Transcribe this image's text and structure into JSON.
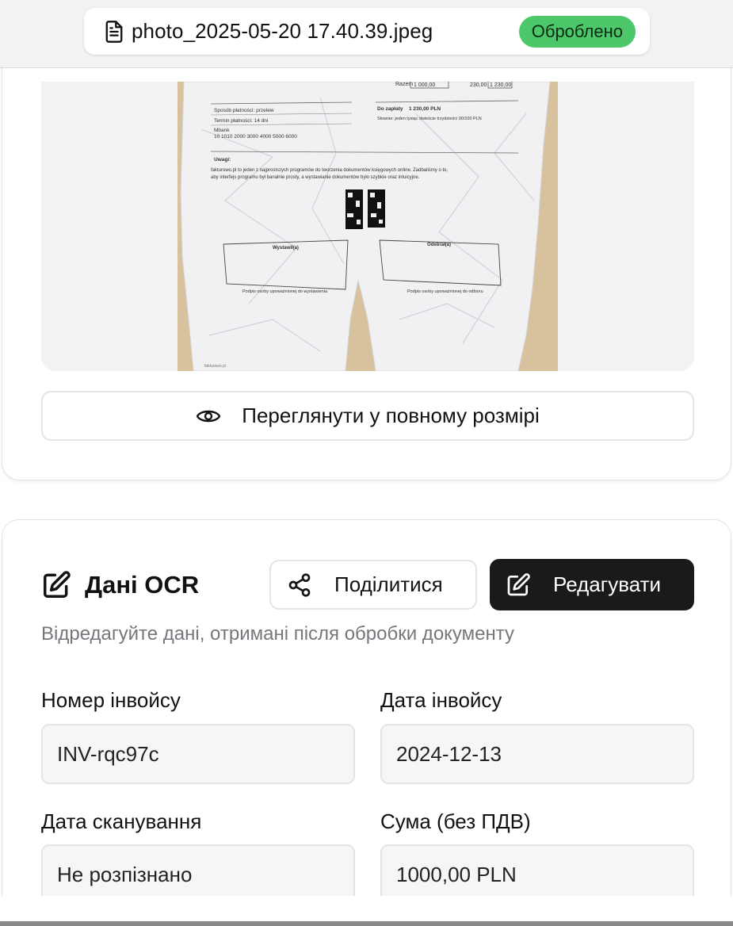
{
  "header": {
    "filename": "photo_2025-05-20 17.40.39.jpeg",
    "status_badge": "Оброблено",
    "file_icon": "document-icon",
    "badge_color": "#4cc76a"
  },
  "preview": {
    "view_full_label": "Переглянути у повному розмірі",
    "view_icon": "eye-icon",
    "receipt_text": {
      "top_value_a": "1 000,00",
      "top_value_b": "230,00",
      "top_value_c": "1 230,00",
      "top_label": "Razem",
      "payment_method": "Sposób płatności: przelew",
      "payment_term": "Termin płatności: 14 dni",
      "bank": "Mbank",
      "account": "10 1010 2000 3000 4000 5000 6000",
      "to_pay": "Do zapłaty",
      "to_pay_value": "1 230,00 PLN",
      "in_words": "Słownie: jeden tysiąc dwieście trzydzieści 00/100 PLN",
      "notes_label": "Uwagi:",
      "notes_line1": "fakturowo.pl to jeden z najprostszych programów do tworzenia dokumentów księgowych online. Zadbaliśmy o to,",
      "notes_line2": "aby interfejs programu był banalnie prosty, a wystawianie dokumentów było szybkie oraz intuicyjne.",
      "issuer_box": "Wystawił(a)",
      "receiver_box": "Odebrał(a)",
      "issuer_sign": "Podpis osoby upoważnionej do wystawienia",
      "receiver_sign": "Podpis osoby upoważnionej do odbioru",
      "footer": "fakturowo.pl"
    }
  },
  "ocr": {
    "title": "Дані OCR",
    "title_icon": "edit-icon",
    "share_label": "Поділитися",
    "share_icon": "share-icon",
    "edit_label": "Редагувати",
    "edit_icon": "edit-icon",
    "subtitle": "Відредагуйте дані, отримані після обробки документу",
    "fields": [
      {
        "label": "Номер інвойсу",
        "value": "INV-rqc97c"
      },
      {
        "label": "Дата інвойсу",
        "value": "2024-12-13"
      },
      {
        "label": "Дата сканування",
        "value": "Не розпізнано"
      },
      {
        "label": "Сума (без ПДВ)",
        "value": "1000,00 PLN"
      }
    ]
  }
}
